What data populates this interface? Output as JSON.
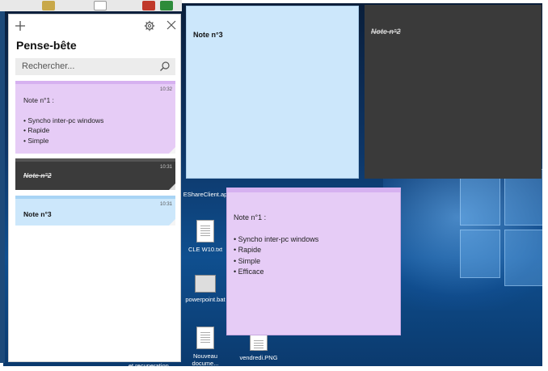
{
  "panel": {
    "title": "Pense-bête",
    "search_placeholder": "Rechercher...",
    "notes": [
      {
        "time": "10:32",
        "title": "Note n°1 :",
        "bullets": [
          "• Syncho inter-pc windows",
          "• Rapide",
          "• Simple"
        ],
        "color": "#e6ccf6"
      },
      {
        "time": "10:31",
        "title": "Note n°2",
        "color": "#3b3b3b"
      },
      {
        "time": "10:31",
        "title": "Note n°3",
        "color": "#cce7fb"
      }
    ]
  },
  "desktop_notes": {
    "blue": {
      "title": "Note n°3"
    },
    "dark": {
      "title": "Note n°2"
    },
    "purple": {
      "title": "Note n°1 :",
      "bullets": [
        "• Syncho inter-pc windows",
        "• Rapide",
        "• Simple",
        "• Efficace"
      ]
    }
  },
  "desktop_icons": {
    "eshare": "EShareClient.ap",
    "cle": "CLE W10.txt",
    "powerpoint": "powerpoint.bat",
    "nouveau": "Nouveau\ndocume...",
    "vendredi": "vendredi.PNG",
    "recuperation": "et recuperation ..."
  },
  "colors": {
    "accent_purple": "#d6b1f0",
    "accent_blue": "#a8d4f5",
    "dark_note": "#3a3a3a"
  }
}
